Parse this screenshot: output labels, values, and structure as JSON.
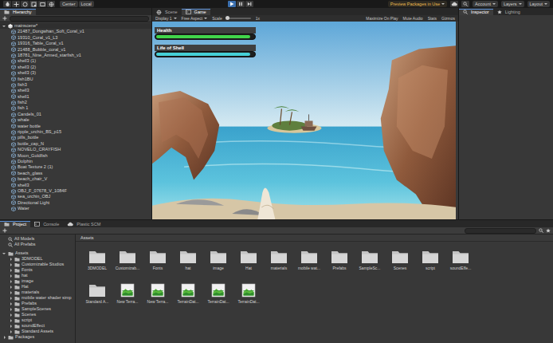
{
  "toolbar": {
    "pivot": "Center",
    "space": "Local",
    "playing": true,
    "packages": "Preview Packages in Use",
    "account": "Account",
    "layers": "Layers",
    "layout": "Layout"
  },
  "hierarchy": {
    "title": "Hierarchy",
    "scene": "mainscene*",
    "expanded": true,
    "items": [
      "21487_Dongwhan_Soft_Coral_v1",
      "19310_Coral_v1_L3",
      "19316_Table_Coral_v1",
      "21488_Bubble_coral_v1",
      "18781_Nine_Armed_starfish_v1",
      "shell3 (1)",
      "shell3 (2)",
      "shell3 (3)",
      "fish1BU",
      "fish3",
      "shell3",
      "shell1",
      "fish2",
      "fish 1",
      "Candels_01",
      "whale",
      "water bottle",
      "ripple_urchin_BS_p15",
      "pills_bottle",
      "bottle_cap_N",
      "NOVELO_CRAYFISH",
      "Moon_Goldfish",
      "Dolphin",
      "Boat Texture 2 (1)",
      "beach_glass",
      "beach_chair_V",
      "shell3",
      "OBJ_F_07678_V_1084F",
      "sea_urchin_OBJ",
      "Directional Light",
      "Water"
    ]
  },
  "view": {
    "tabs": [
      {
        "label": "Scene",
        "selected": false
      },
      {
        "label": "Game",
        "selected": true
      }
    ],
    "display": "Display 1",
    "aspect": "Free Aspect",
    "scale": "Scale",
    "scale_level": 0,
    "zoom": "1x",
    "options": [
      "Maximize On Play",
      "Mute Audio",
      "Stats",
      "Gizmos"
    ],
    "hud": [
      {
        "label": "Health",
        "level": 0.96,
        "color": "#41d54a"
      },
      {
        "label": "Life of Shell",
        "level": 0.96,
        "color": "#45cfd6"
      }
    ]
  },
  "inspector": {
    "tabs": [
      {
        "label": "Inspector",
        "selected": true
      },
      {
        "label": "Lighting",
        "selected": false
      }
    ]
  },
  "project": {
    "tabs": [
      {
        "label": "Project",
        "selected": true
      },
      {
        "label": "Console",
        "selected": false
      },
      {
        "label": "Plastic SCM",
        "selected": false
      }
    ],
    "favorites": [
      "All Models",
      "All Prefabs"
    ],
    "root": "Assets",
    "root_expanded": true,
    "folders": [
      "3DMODEL",
      "Customizable Studios",
      "Fonts",
      "hat",
      "image",
      "Hat",
      "materials",
      "mobile water shader simp",
      "Prefabs",
      "SampleScenes",
      "Scenes",
      "script",
      "soundEffect",
      "Standard Assets"
    ],
    "packages": "Packages",
    "breadcrumb": "Assets",
    "assets": [
      {
        "label": "3DMODEL",
        "kind": "folder"
      },
      {
        "label": "Customizab...",
        "kind": "folder"
      },
      {
        "label": "Fonts",
        "kind": "folder"
      },
      {
        "label": "hat",
        "kind": "folder"
      },
      {
        "label": "image",
        "kind": "folder"
      },
      {
        "label": "Hat",
        "kind": "folder"
      },
      {
        "label": "materials",
        "kind": "folder"
      },
      {
        "label": "mobile wat...",
        "kind": "folder"
      },
      {
        "label": "Prefabs",
        "kind": "folder"
      },
      {
        "label": "SampleSc...",
        "kind": "folder"
      },
      {
        "label": "Scenes",
        "kind": "folder"
      },
      {
        "label": "script",
        "kind": "folder"
      },
      {
        "label": "soundEffe...",
        "kind": "folder"
      },
      {
        "label": "Standard A...",
        "kind": "folder"
      },
      {
        "label": "New Terra...",
        "kind": "terrain"
      },
      {
        "label": "New Terra...",
        "kind": "terrain"
      },
      {
        "label": "TerrainDat...",
        "kind": "terrain"
      },
      {
        "label": "TerrainDat...",
        "kind": "terrain"
      },
      {
        "label": "TerrainDat...",
        "kind": "terrain"
      }
    ]
  }
}
